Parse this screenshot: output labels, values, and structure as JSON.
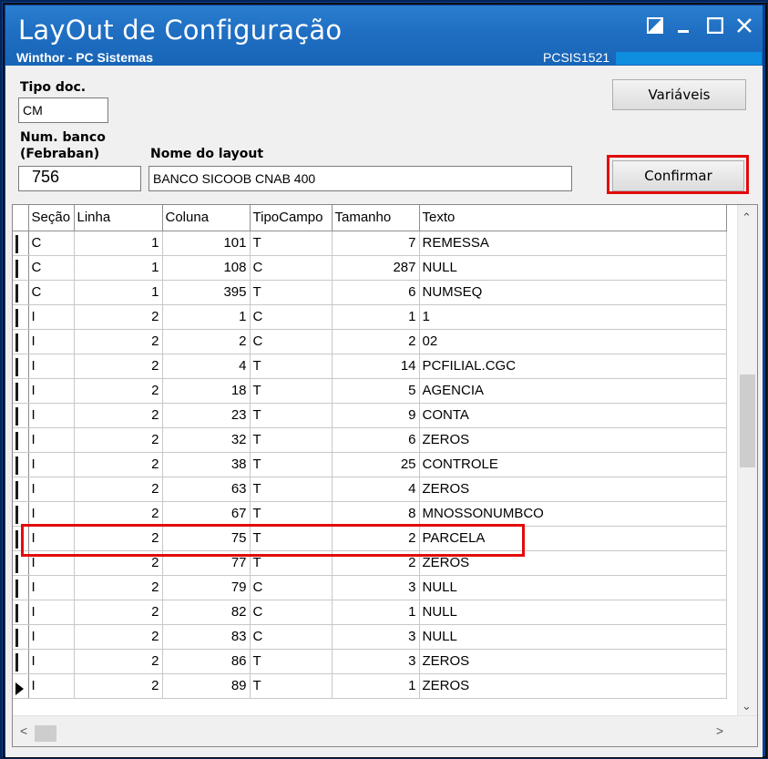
{
  "window": {
    "title": "LayOut de Configuração",
    "subtitle": "Winthor - PC Sistemas",
    "code": "PCSIS1521",
    "controls": [
      "restore-icon",
      "minimize-icon",
      "maximize-icon",
      "close-icon"
    ]
  },
  "form": {
    "tipo_doc_label": "Tipo doc.",
    "tipo_doc_value": "CM",
    "num_banco_label_1": "Num. banco",
    "num_banco_label_2": "(Febraban)",
    "num_banco_value": "756",
    "nome_layout_label": "Nome do layout",
    "nome_layout_value": "BANCO SICOOB CNAB 400",
    "variaveis_button": "Variáveis",
    "confirmar_button": "Confirmar"
  },
  "grid": {
    "columns": [
      "Seção",
      "Linha",
      "Coluna",
      "TipoCampo",
      "Tamanho",
      "Texto"
    ],
    "rows": [
      [
        "C",
        "1",
        "101",
        "T",
        "7",
        "REMESSA"
      ],
      [
        "C",
        "1",
        "108",
        "C",
        "287",
        "NULL"
      ],
      [
        "C",
        "1",
        "395",
        "T",
        "6",
        "NUMSEQ"
      ],
      [
        "I",
        "2",
        "1",
        "C",
        "1",
        "1"
      ],
      [
        "I",
        "2",
        "2",
        "C",
        "2",
        "02"
      ],
      [
        "I",
        "2",
        "4",
        "T",
        "14",
        "PCFILIAL.CGC"
      ],
      [
        "I",
        "2",
        "18",
        "T",
        "5",
        "AGENCIA"
      ],
      [
        "I",
        "2",
        "23",
        "T",
        "9",
        "CONTA"
      ],
      [
        "I",
        "2",
        "32",
        "T",
        "6",
        "ZEROS"
      ],
      [
        "I",
        "2",
        "38",
        "T",
        "25",
        "CONTROLE"
      ],
      [
        "I",
        "2",
        "63",
        "T",
        "4",
        "ZEROS"
      ],
      [
        "I",
        "2",
        "67",
        "T",
        "8",
        "MNOSSONUMBCO"
      ],
      [
        "I",
        "2",
        "75",
        "T",
        "2",
        "PARCELA"
      ],
      [
        "I",
        "2",
        "77",
        "T",
        "2",
        "ZEROS"
      ],
      [
        "I",
        "2",
        "79",
        "C",
        "3",
        "NULL"
      ],
      [
        "I",
        "2",
        "82",
        "C",
        "1",
        "NULL"
      ],
      [
        "I",
        "2",
        "83",
        "C",
        "3",
        "NULL"
      ],
      [
        "I",
        "2",
        "86",
        "T",
        "3",
        "ZEROS"
      ],
      [
        "I",
        "2",
        "89",
        "T",
        "1",
        "ZEROS"
      ]
    ],
    "current_row": 18,
    "highlighted_row": 12
  },
  "colors": {
    "titlebar": "#1f6ec2",
    "highlight": "#e30b0b"
  }
}
